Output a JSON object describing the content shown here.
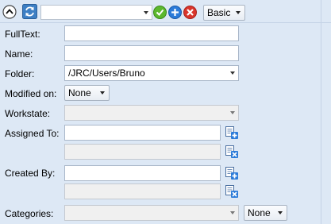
{
  "toolbar": {
    "collapse_icon": "chevron-up-icon",
    "refresh_icon": "refresh-icon",
    "query_select_value": "",
    "accept_icon": "check-icon",
    "add_icon": "plus-icon",
    "remove_icon": "close-icon",
    "mode_value": "Basic"
  },
  "fields": {
    "fulltext": {
      "label": "FullText:",
      "value": ""
    },
    "name": {
      "label": "Name:",
      "value": ""
    },
    "folder": {
      "label": "Folder:",
      "value": "/JRC/Users/Bruno"
    },
    "modified_on": {
      "label": "Modified on:",
      "value": "None"
    },
    "workstate": {
      "label": "Workstate:",
      "value": ""
    },
    "assigned_to": {
      "label": "Assigned To:",
      "value": "",
      "value2": ""
    },
    "created_by": {
      "label": "Created By:",
      "value": "",
      "value2": ""
    },
    "categories": {
      "label": "Categories:",
      "value": "",
      "operator": "None"
    }
  },
  "colors": {
    "background": "#dde8f5",
    "accept_green": "#5cb82e",
    "add_blue": "#2b7bd9",
    "remove_red": "#d9352c"
  }
}
